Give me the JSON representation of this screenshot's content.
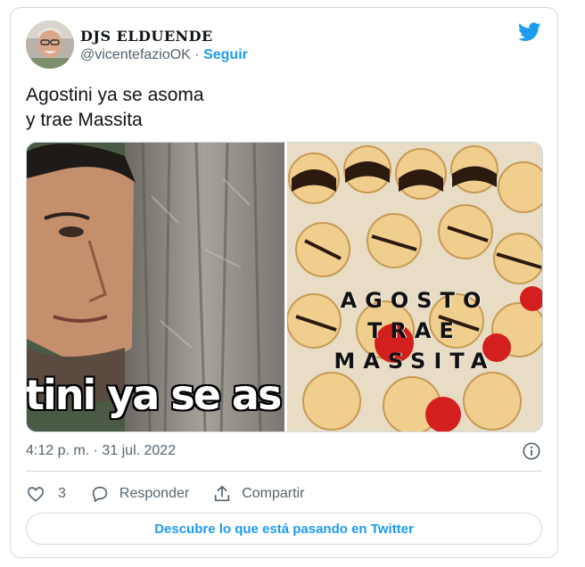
{
  "tweet": {
    "display_name": "DJS ELDUENDE",
    "handle": "@vicentefazioOK",
    "separator": " · ",
    "follow_label": "Seguir",
    "text": "Agostini ya se asoma\ny trae Massita",
    "media": {
      "left_caption": "tini ya se as",
      "right_caption_lines": [
        "AGOSTO",
        "TRAE",
        "MASSITA"
      ]
    },
    "timestamp": "4:12 p. m. · 31 jul. 2022",
    "like_count": "3",
    "reply_label": "Responder",
    "share_label": "Compartir",
    "cta_label": "Descubre lo que está pasando en Twitter"
  },
  "colors": {
    "accent": "#1d9bf0",
    "text": "#0f1419",
    "secondary": "#536471",
    "border": "#cfd9de"
  },
  "icons": [
    "twitter-bird-icon",
    "info-icon",
    "heart-icon",
    "reply-icon",
    "share-icon"
  ]
}
